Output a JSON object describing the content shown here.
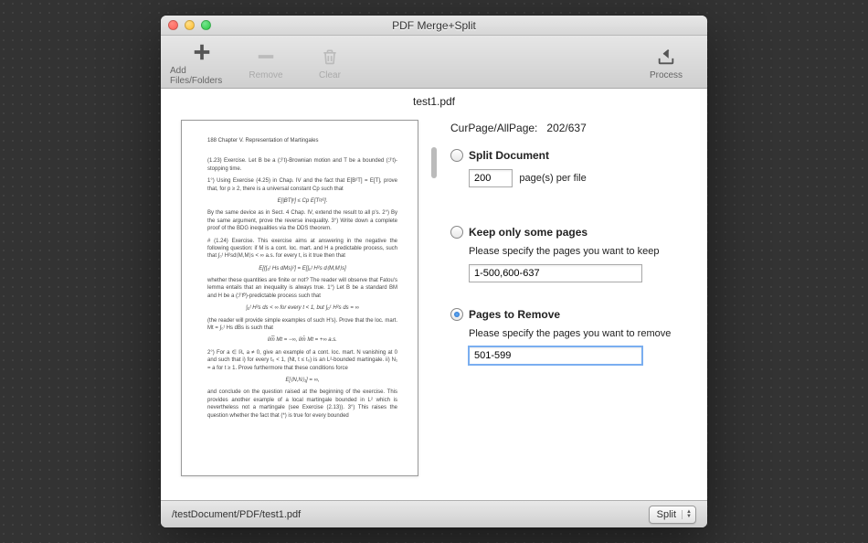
{
  "window": {
    "title": "PDF Merge+Split"
  },
  "toolbar": {
    "add": "Add Files/Folders",
    "remove": "Remove",
    "clear": "Clear",
    "process": "Process"
  },
  "file": {
    "display_name": "test1.pdf",
    "path": "/testDocument/PDF/test1.pdf"
  },
  "page_info": {
    "label": "CurPage/AllPage:",
    "value": "202/637"
  },
  "split": {
    "label": "Split  Document",
    "value": "200",
    "suffix": "page(s) per file"
  },
  "keep": {
    "label": "Keep only some pages",
    "desc": "Please specify the pages you want to keep",
    "value": "1-500,600-637"
  },
  "remove": {
    "label": "Pages to Remove",
    "desc": "Please specify the pages you want to remove",
    "value": "501-599"
  },
  "selected_option": "remove",
  "action_popup": {
    "value": "Split"
  },
  "preview_page": {
    "header": "188    Chapter V.  Representation of Martingales",
    "lines": [
      "(1.23) Exercise. Let B be a (ℱt)-Brownian motion and T be a bounded (ℱt)-stopping time.",
      "1°) Using Exercise (4.25) in Chap. IV and the fact that E[B²T] = E[T], prove that, for p ≥ 2, there is a universal constant Cp such that",
      "E[|BT|ᵖ] ≤ Cp E[Tᵖ/²].",
      "By the same device as in Sect. 4 Chap. IV, extend the result to all p's.  2°) By the same argument, prove the reverse inequality.  3°) Write down a complete proof of the BDG inequalities via the DDS theorem.",
      "# (1.24) Exercise. This exercise aims at answering in the negative the following question: if M is a cont. loc. mart. and H a predictable process, such that ∫₀ᵗ H²sd⟨M,M⟩s < ∞ a.s. for every t, is it true then that",
      "E[(∫₀ᵗ Hs dMs)²] = E[∫₀ᵗ H²s d⟨M,M⟩s]",
      "whether these quantities are finite or not? The reader will observe that Fatou's lemma entails that an inequality is always true.  1°) Let B be a standard BM and H be a (ℱtᴮ)-predictable process such that",
      "∫₀ᵗ H²s ds < ∞  for every t < 1,   but   ∫₀¹ H²s ds = ∞",
      "(the reader will provide simple examples of such H's). Prove that the loc. mart. Mt = ∫₀ᵗ Hs dBs is such that",
      "lim̅ Mt = −∞,    lim̄ Mt = +∞  a.s.",
      "2°) For a ∈ ℝ, a ≠ 0, give an example of a cont. loc. mart. N vanishing at 0 and such that  i) for every t₀ < 1, (Nt, t ≤ t₀) is an L²-bounded martingale.  ii) N₁ = a for t ≥ 1.  Prove furthermore that these conditions force",
      "E[⟨N,N⟩₁] = ∞,",
      "and conclude on the question raised at the beginning of the exercise. This provides another example of a local martingale bounded in L² which is nevertheless not a martingale (see Exercise (2.13)).  3°) This raises the question whether the fact that (*) is true for every bounded"
    ]
  }
}
